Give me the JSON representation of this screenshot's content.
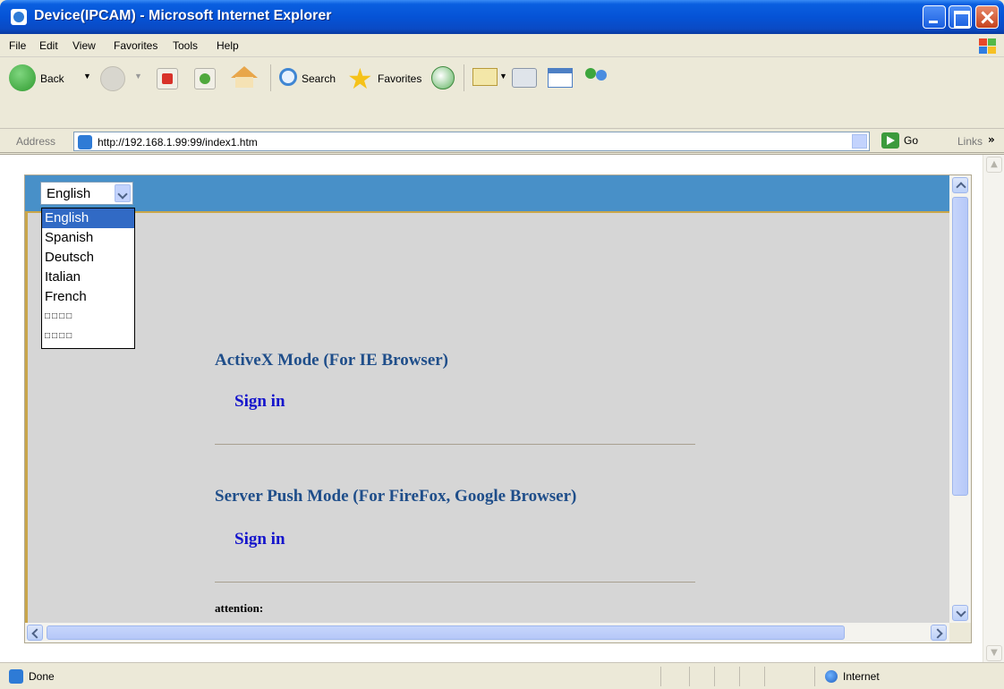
{
  "window": {
    "title": "Device(IPCAM) - Microsoft Internet Explorer"
  },
  "menu": {
    "items": [
      "File",
      "Edit",
      "View",
      "Favorites",
      "Tools",
      "Help"
    ]
  },
  "toolbar": {
    "back_label": "Back",
    "search_label": "Search",
    "favorites_label": "Favorites"
  },
  "address": {
    "label": "Address",
    "url": "http://192.168.1.99:99/index1.htm",
    "go_label": "Go",
    "links_label": "Links"
  },
  "page": {
    "language": {
      "selected": "English",
      "options": [
        "English",
        "Spanish",
        "Deutsch",
        "Italian",
        "French",
        "□□□□",
        "□□□□"
      ]
    },
    "activex_title": "ActiveX Mode (For IE Browser)",
    "activex_signin": "Sign in",
    "push_title": "Server Push Mode (For FireFox, Google Browser)",
    "push_signin": "Sign in",
    "attention_label": "attention:"
  },
  "status": {
    "text": "Done",
    "zone": "Internet"
  }
}
